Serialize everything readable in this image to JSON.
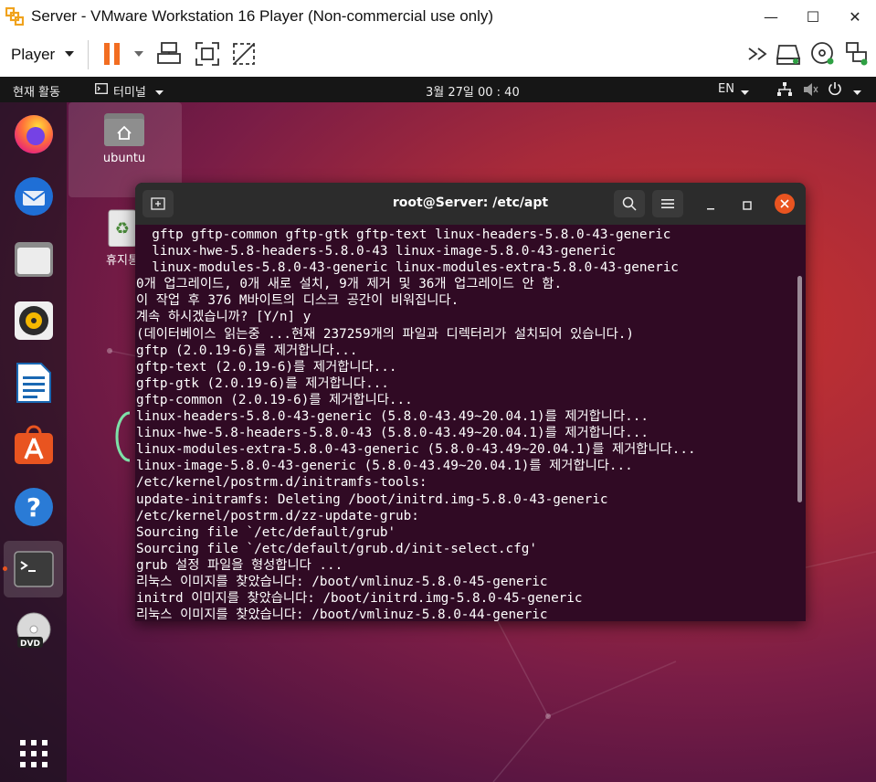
{
  "window": {
    "title": "Server - VMware Workstation 16 Player (Non-commercial use only)",
    "minimize": "—",
    "maximize": "☐",
    "close": "✕"
  },
  "toolbar": {
    "player_label": "Player",
    "icons": [
      "pause-icon",
      "send-ctrl-alt-del-icon",
      "fullscreen-icon",
      "unity-icon",
      "more-icon",
      "hdd-icon",
      "cd-icon",
      "network-icon"
    ]
  },
  "ubuntu": {
    "activities": "현재 활동",
    "terminal_menu": "터미널",
    "clock": "3월 27일 00 : 40",
    "input_method": "EN",
    "desktop_icons": [
      {
        "label": "ubuntu"
      },
      {
        "label": "휴지통"
      }
    ]
  },
  "terminal": {
    "title": "root@Server: /etc/apt",
    "lines": [
      "  gftp gftp-common gftp-gtk gftp-text linux-headers-5.8.0-43-generic",
      "  linux-hwe-5.8-headers-5.8.0-43 linux-image-5.8.0-43-generic",
      "  linux-modules-5.8.0-43-generic linux-modules-extra-5.8.0-43-generic",
      "0개 업그레이드, 0개 새로 설치, 9개 제거 및 36개 업그레이드 안 함.",
      "이 작업 후 376 M바이트의 디스크 공간이 비워집니다.",
      "계속 하시겠습니까? [Y/n] y",
      "(데이터베이스 읽는중 ...현재 237259개의 파일과 디렉터리가 설치되어 있습니다.)",
      "gftp (2.0.19-6)를 제거합니다...",
      "gftp-text (2.0.19-6)를 제거합니다...",
      "gftp-gtk (2.0.19-6)를 제거합니다...",
      "gftp-common (2.0.19-6)를 제거합니다...",
      "linux-headers-5.8.0-43-generic (5.8.0-43.49~20.04.1)를 제거합니다...",
      "linux-hwe-5.8-headers-5.8.0-43 (5.8.0-43.49~20.04.1)를 제거합니다...",
      "linux-modules-extra-5.8.0-43-generic (5.8.0-43.49~20.04.1)를 제거합니다...",
      "linux-image-5.8.0-43-generic (5.8.0-43.49~20.04.1)를 제거합니다...",
      "/etc/kernel/postrm.d/initramfs-tools:",
      "update-initramfs: Deleting /boot/initrd.img-5.8.0-43-generic",
      "/etc/kernel/postrm.d/zz-update-grub:",
      "Sourcing file `/etc/default/grub'",
      "Sourcing file `/etc/default/grub.d/init-select.cfg'",
      "grub 설정 파일을 형성합니다 ...",
      "리눅스 이미지를 찾았습니다: /boot/vmlinuz-5.8.0-45-generic",
      "initrd 이미지를 찾았습니다: /boot/initrd.img-5.8.0-45-generic",
      "리눅스 이미지를 찾았습니다: /boot/vmlinuz-5.8.0-44-generic"
    ]
  },
  "colors": {
    "terminal_bg": "#300a24",
    "accent_pause": "#f26d21",
    "close_button": "#e95420"
  }
}
